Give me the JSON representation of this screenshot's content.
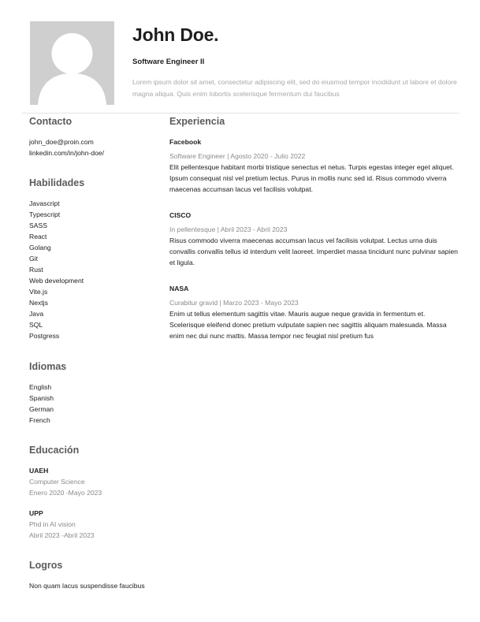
{
  "header": {
    "name": "John Doe.",
    "role": "Software Engineer II",
    "summary": "Lorem ipsum dolor sit amet, consectetur adipiscing elit, sed do eiusmod tempor incididunt ut labore et dolore magna aliqua. Quis enim lobortis scelerisque fermentum dui faucibus"
  },
  "contact": {
    "title": "Contacto",
    "email": "john_doe@proin.com",
    "linkedin": "linkedin.com/in/john-doe/"
  },
  "skills": {
    "title": "Habilidades",
    "items": [
      "Javascript",
      "Typescript",
      "SASS",
      "React",
      "Golang",
      "Git",
      "Rust",
      "Web development",
      "Vite.js",
      "Nextjs",
      "Java",
      "SQL",
      "Postgress"
    ]
  },
  "languages": {
    "title": "Idiomas",
    "items": [
      "English",
      "Spanish",
      "German",
      "French"
    ]
  },
  "education": {
    "title": "Educación",
    "items": [
      {
        "school": "UAEH",
        "degree": "Computer Science",
        "dates": "Enero 2020 -Mayo 2023"
      },
      {
        "school": "UPP",
        "degree": "Phd in AI vision",
        "dates": "Abril 2023 -Abril 2023"
      }
    ]
  },
  "achievements": {
    "title": "Logros",
    "items": [
      "Non quam lacus suspendisse faucibus"
    ]
  },
  "experience": {
    "title": "Experiencia",
    "jobs": [
      {
        "company": "Facebook",
        "meta": "Software Engineer | Agosto 2020 - Julio 2022",
        "description": "Elit pellentesque habitant morbi tristique senectus et netus. Turpis egestas integer eget aliquet. Ipsum consequat nisl vel pretium lectus. Purus in mollis nunc sed id. Risus commodo viverra maecenas accumsan lacus vel facilisis volutpat."
      },
      {
        "company": "CISCO",
        "meta": "In pellentesque | Abril 2023 - Abril 2023",
        "description": "Risus commodo viverra maecenas accumsan lacus vel facilisis volutpat. Lectus urna duis convallis convallis tellus id interdum velit laoreet. Imperdiet massa tincidunt nunc pulvinar sapien et ligula."
      },
      {
        "company": "NASA",
        "meta": "Curabitur gravid | Marzo 2023 - Mayo 2023",
        "description": "Enim ut tellus elementum sagittis vitae. Mauris augue neque gravida in fermentum et. Scelerisque eleifend donec pretium vulputate sapien nec sagittis aliquam malesuada. Massa enim nec dui nunc mattis. Massa tempor nec feugiat nisl pretium fus"
      }
    ]
  },
  "colors": {
    "photo_bg": "#cfcfcf",
    "section_title": "#5b5b5b",
    "muted_text": "#8a8a8a",
    "summary_text": "#a8a8a8"
  },
  "icons": {
    "avatar": "person-silhouette-icon"
  }
}
